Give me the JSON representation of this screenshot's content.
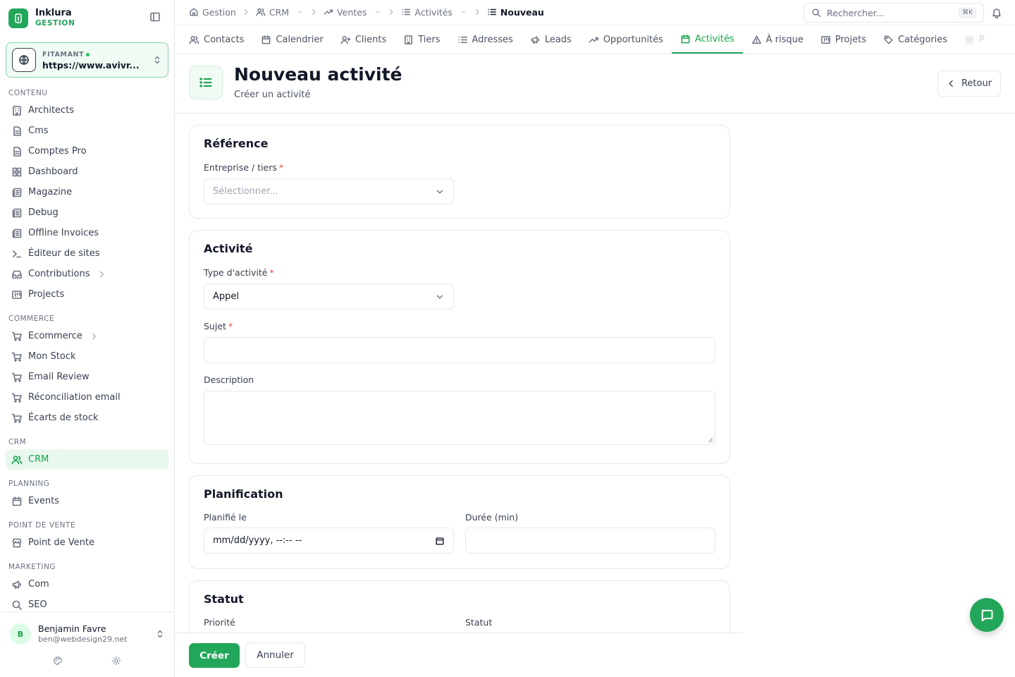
{
  "brand": {
    "name": "Inklura",
    "sub": "GESTION"
  },
  "org": {
    "label": "FITAMANT",
    "url": "https://www.avivr..."
  },
  "sidebar": {
    "sections": [
      {
        "title": "CONTENU",
        "items": [
          {
            "label": "Architects",
            "icon": "building-icon"
          },
          {
            "label": "Cms",
            "icon": "file-icon"
          },
          {
            "label": "Comptes Pro",
            "icon": "file-icon"
          },
          {
            "label": "Dashboard",
            "icon": "dashboard-icon"
          },
          {
            "label": "Magazine",
            "icon": "newspaper-icon"
          },
          {
            "label": "Debug",
            "icon": "newspaper-icon"
          },
          {
            "label": "Offline Invoices",
            "icon": "newspaper-icon"
          },
          {
            "label": "Éditeur de sites",
            "icon": "terminal-icon"
          },
          {
            "label": "Contributions",
            "icon": "inbox-icon",
            "has_children": true
          },
          {
            "label": "Projects",
            "icon": "kanban-icon"
          }
        ]
      },
      {
        "title": "COMMERCE",
        "items": [
          {
            "label": "Ecommerce",
            "icon": "cart-icon",
            "has_children": true
          },
          {
            "label": "Mon Stock",
            "icon": "cart-icon"
          },
          {
            "label": "Email Review",
            "icon": "cart-icon"
          },
          {
            "label": "Réconciliation email",
            "icon": "cart-icon"
          },
          {
            "label": "Écarts de stock",
            "icon": "cart-icon"
          }
        ]
      },
      {
        "title": "CRM",
        "items": [
          {
            "label": "CRM",
            "icon": "users-icon",
            "active": true
          }
        ]
      },
      {
        "title": "PLANNING",
        "items": [
          {
            "label": "Events",
            "icon": "calendar-icon"
          }
        ]
      },
      {
        "title": "POINT DE VENTE",
        "items": [
          {
            "label": "Point de Vente",
            "icon": "store-icon"
          }
        ]
      },
      {
        "title": "MARKETING",
        "items": [
          {
            "label": "Com",
            "icon": "megaphone-icon"
          },
          {
            "label": "SEO",
            "icon": "search-icon"
          }
        ]
      }
    ]
  },
  "user": {
    "initial": "B",
    "name": "Benjamin Favre",
    "email": "ben@webdesign29.net"
  },
  "breadcrumb": [
    {
      "label": "Gestion",
      "icon": "home-icon",
      "dropdown": false
    },
    {
      "label": "CRM",
      "icon": "users-icon",
      "dropdown": true
    },
    {
      "label": "Ventes",
      "icon": "trend-icon",
      "dropdown": true
    },
    {
      "label": "Activités",
      "icon": "list-icon",
      "dropdown": true
    },
    {
      "label": "Nouveau",
      "icon": "list-icon",
      "dropdown": false,
      "current": true
    }
  ],
  "search": {
    "placeholder": "Rechercher...",
    "shortcut": "⌘K"
  },
  "tabs": [
    {
      "label": "Contacts",
      "icon": "users-icon"
    },
    {
      "label": "Calendrier",
      "icon": "calendar-icon"
    },
    {
      "label": "Clients",
      "icon": "user-plus-icon"
    },
    {
      "label": "Tiers",
      "icon": "building-icon"
    },
    {
      "label": "Adresses",
      "icon": "list-icon"
    },
    {
      "label": "Leads",
      "icon": "megaphone-icon"
    },
    {
      "label": "Opportunités",
      "icon": "trend-icon"
    },
    {
      "label": "Activités",
      "icon": "calendar-icon",
      "active": true
    },
    {
      "label": "À risque",
      "icon": "warning-icon"
    },
    {
      "label": "Projets",
      "icon": "kanban-icon"
    },
    {
      "label": "Catégories",
      "icon": "tag-icon"
    },
    {
      "label": "P",
      "icon": "gear-icon",
      "faded": true
    }
  ],
  "page": {
    "title": "Nouveau activité",
    "subtitle": "Créer un activité",
    "back_label": "Retour"
  },
  "form": {
    "reference": {
      "title": "Référence",
      "entreprise_label": "Entreprise / tiers",
      "entreprise_placeholder": "Sélectionner..."
    },
    "activite": {
      "title": "Activité",
      "type_label": "Type d'activité",
      "type_value": "Appel",
      "sujet_label": "Sujet",
      "sujet_value": "",
      "description_label": "Description",
      "description_value": ""
    },
    "planification": {
      "title": "Planification",
      "planifie_label": "Planifié le",
      "planifie_value": "mm/dd/yyyy, --:-- --",
      "duree_label": "Durée (min)",
      "duree_value": ""
    },
    "statut": {
      "title": "Statut",
      "priorite_label": "Priorité",
      "statut_label": "Statut"
    }
  },
  "actions": {
    "submit_label": "Créer",
    "cancel_label": "Annuler"
  },
  "colors": {
    "accent": "#22a65a",
    "accent_light": "#f0fbf4",
    "required": "#ef4444"
  }
}
